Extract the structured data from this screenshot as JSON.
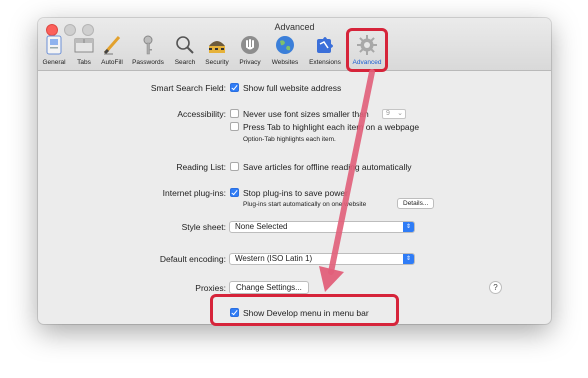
{
  "window": {
    "title": "Advanced"
  },
  "toolbar": {
    "items": [
      {
        "label": "General",
        "icon": "general-icon"
      },
      {
        "label": "Tabs",
        "icon": "tabs-icon"
      },
      {
        "label": "AutoFill",
        "icon": "autofill-icon"
      },
      {
        "label": "Passwords",
        "icon": "key-icon"
      },
      {
        "label": "Search",
        "icon": "search-icon"
      },
      {
        "label": "Security",
        "icon": "security-icon"
      },
      {
        "label": "Privacy",
        "icon": "privacy-icon"
      },
      {
        "label": "Websites",
        "icon": "globe-icon"
      },
      {
        "label": "Extensions",
        "icon": "puzzle-icon"
      },
      {
        "label": "Advanced",
        "icon": "gear-icon"
      }
    ],
    "selected": "Advanced"
  },
  "settings": {
    "smart_search": {
      "label": "Smart Search Field:",
      "option": "Show full website address",
      "checked": true
    },
    "accessibility": {
      "label": "Accessibility:",
      "font_option": "Never use font sizes smaller than",
      "font_size": "9",
      "tab_option": "Press Tab to highlight each item on a webpage",
      "tab_note": "Option-Tab highlights each item."
    },
    "reading_list": {
      "label": "Reading List:",
      "option": "Save articles for offline reading automatically"
    },
    "plugins": {
      "label": "Internet plug-ins:",
      "option": "Stop plug-ins to save power",
      "note": "Plug-ins start automatically on one website",
      "details_button": "Details..."
    },
    "style_sheet": {
      "label": "Style sheet:",
      "value": "None Selected"
    },
    "encoding": {
      "label": "Default encoding:",
      "value": "Western (ISO Latin 1)"
    },
    "proxies": {
      "label": "Proxies:",
      "button": "Change Settings..."
    },
    "develop": {
      "option": "Show Develop menu in menu bar",
      "checked": true
    },
    "help": "?"
  },
  "colors": {
    "accent": "#2f7cf6",
    "highlight": "#d6243a",
    "arrow": "#e2607a"
  }
}
